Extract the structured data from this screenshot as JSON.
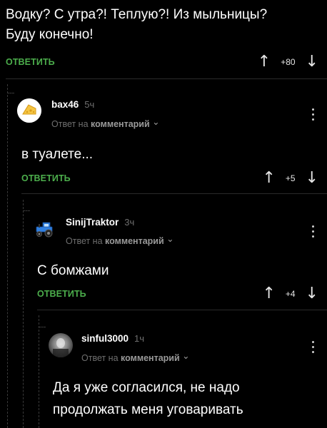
{
  "comments": [
    {
      "body_lines": [
        "Водку?  С утра?! Теплую?! Из мыльницы?",
        "Буду конечно!"
      ],
      "reply_label": "ОТВЕТИТЬ",
      "rating": "+80"
    },
    {
      "username": "bax46",
      "time": "5ч",
      "reply_prefix": "Ответ на",
      "reply_target": "комментарий",
      "body": "в туалете...",
      "reply_label": "ОТВЕТИТЬ",
      "rating": "+5",
      "avatar_icon": "cheese-avatar"
    },
    {
      "username": "SinijTraktor",
      "time": "3ч",
      "reply_prefix": "Ответ на",
      "reply_target": "комментарий",
      "body": "С бомжами",
      "reply_label": "ОТВЕТИТЬ",
      "rating": "+4",
      "avatar_icon": "blue-tractor-avatar"
    },
    {
      "username": "sinful3000",
      "time": "1ч",
      "reply_prefix": "Ответ на",
      "reply_target": "комментарий",
      "body_lines": [
        "Да я уже согласился, не надо",
        "продолжать меня уговаривать"
      ],
      "avatar_icon": "photo-avatar"
    }
  ],
  "icons": {
    "upvote": "↑",
    "downvote": "↓",
    "chevron": "⌄"
  },
  "colors": {
    "background": "#000000",
    "accent_green": "#4cae4c",
    "muted": "#6f6f6f"
  }
}
